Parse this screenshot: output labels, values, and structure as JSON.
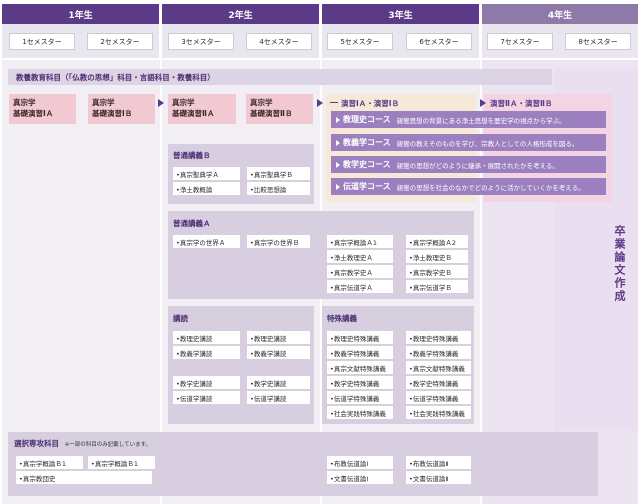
{
  "years": [
    "1年生",
    "2年生",
    "3年生",
    "4年生"
  ],
  "semesters": [
    "1セメスター",
    "2セメスター",
    "3セメスター",
    "4セメスター",
    "5セメスター",
    "6セメスター",
    "7セメスター",
    "8セメスター"
  ],
  "liberal_arts": {
    "title": "教養教育科目（「仏教の思想」科目・言語科目・教養科目）"
  },
  "seminars": [
    "真宗学\n基礎演習ⅠＡ",
    "真宗学\n基礎演習ⅠＢ",
    "真宗学\n基礎演習ⅡＡ",
    "真宗学\n基礎演習ⅡＢ"
  ],
  "seminar3": {
    "title": "演習ⅠＡ・演習ⅠＢ",
    "courses": [
      {
        "name": "教理史コース",
        "desc": "親鸞思想の背景にある浄土思想を歴史学の視点から学ぶ。"
      },
      {
        "name": "教義学コース",
        "desc": "親鸞の教えそのものを学び、宗教人としての人格形成を図る。"
      },
      {
        "name": "教学史コース",
        "desc": "親鸞の思想がどのように継承・展開されたかを考える。"
      },
      {
        "name": "伝道学コース",
        "desc": "親鸞の思想を社会のなかでどのように活かしていくかを考える。"
      }
    ]
  },
  "seminar4": {
    "title": "演習ⅡＡ・演習ⅡＢ"
  },
  "graduation": "卒業論文作成",
  "general_b": {
    "title": "普通講義Ｂ",
    "items": [
      "•真宗聖典学Ａ",
      "•真宗聖典学Ｂ",
      "•浄土教概論",
      "•比較思想論"
    ]
  },
  "general_a": {
    "title": "普通講義Ａ",
    "items_y2": [
      "•真宗学の世界Ａ",
      "•真宗学の世界Ｂ"
    ],
    "items_y3": [
      "•真宗学概論Ａ1",
      "•真宗学概論Ａ2",
      "•浄土教理史Ａ",
      "•浄土教理史Ｂ",
      "•真宗教学史Ａ",
      "•真宗教学史Ｂ",
      "•真宗伝道学Ａ",
      "•真宗伝道学Ｂ"
    ]
  },
  "lectures": {
    "title": "講読",
    "items_group1": [
      "•教理史講読",
      "•教理史講読",
      "•教義学講読",
      "•教義学講読"
    ],
    "items_group2": [
      "•教学史講読",
      "•教学史講読",
      "•伝道学講読",
      "•伝道学講読"
    ]
  },
  "special": {
    "title": "特殊講義",
    "items": [
      "•教理史特殊講義",
      "•教理史特殊講義",
      "•教義学特殊講義",
      "•教義学特殊講義",
      "•真宗文献特殊講義",
      "•真宗文献特殊講義",
      "•教学史特殊講義",
      "•教学史特殊講義",
      "•伝道学特殊講義",
      "•伝道学特殊講義",
      "•社会実践特殊講義",
      "•社会実践特殊講義"
    ]
  },
  "elective": {
    "title": "選択専攻科目",
    "note": "※一部の科目のみ記載しています。",
    "items_left": [
      "•真宗学概論Ｂ1",
      "•真宗学概論Ｂ1",
      "•真宗教団史"
    ],
    "items_right": [
      "•布教伝道論Ⅰ",
      "•布教伝道論Ⅱ",
      "•文書伝道論Ⅰ",
      "•文書伝道論Ⅱ"
    ]
  }
}
